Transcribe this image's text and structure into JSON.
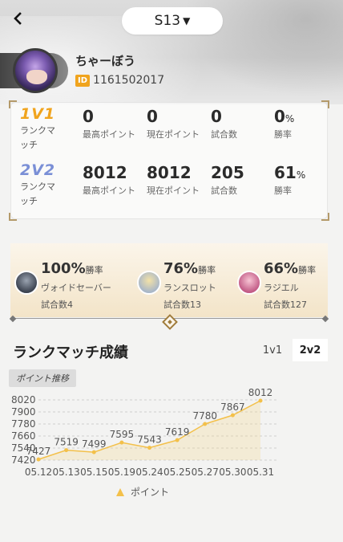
{
  "header": {
    "back_icon": "back-arrow-icon",
    "season": "S13",
    "season_arrow": "▼"
  },
  "profile": {
    "name": "ちゃーぼう",
    "id_badge": "ID",
    "id": "1161502017"
  },
  "modes": [
    {
      "badge": "1V1",
      "label": "ランクマッチ",
      "highest_points": "0",
      "highest_points_label": "最高ポイント",
      "current_points": "0",
      "current_points_label": "現在ポイント",
      "matches": "0",
      "matches_label": "試合数",
      "win_rate": "0",
      "win_rate_unit": "%",
      "win_rate_label": "勝率"
    },
    {
      "badge": "2V2",
      "label": "ランクマッチ",
      "highest_points": "8012",
      "highest_points_label": "最高ポイント",
      "current_points": "8012",
      "current_points_label": "現在ポイント",
      "matches": "205",
      "matches_label": "試合数",
      "win_rate": "61",
      "win_rate_unit": "%",
      "win_rate_label": "勝率"
    }
  ],
  "heroes": [
    {
      "rate": "100%",
      "rate_label": "勝率",
      "name": "ヴォイドセーバー",
      "matches": "試合数4"
    },
    {
      "rate": "76%",
      "rate_label": "勝率",
      "name": "ランスロット",
      "matches": "試合数13"
    },
    {
      "rate": "66%",
      "rate_label": "勝率",
      "name": "ラジエル",
      "matches": "試合数127"
    }
  ],
  "rank_section": {
    "title": "ランクマッチ成績",
    "tab_1v1": "1v1",
    "tab_2v2": "2v2",
    "selected_tab": "2v2",
    "chart_tag": "ポイント推移",
    "legend": "ポイント"
  },
  "colors": {
    "line": "#f3c04a",
    "gold_badge": "#f0a41e",
    "blue_badge": "#7a8fd6"
  },
  "chart_data": {
    "type": "line",
    "x": [
      "05.12",
      "05.13",
      "05.15",
      "05.19",
      "05.24",
      "05.25",
      "05.27",
      "05.30",
      "05.31"
    ],
    "series": [
      {
        "name": "ポイント",
        "values": [
          7427,
          7519,
          7499,
          7595,
          7543,
          7619,
          7780,
          7867,
          8012
        ]
      }
    ],
    "yticks": [
      8020,
      7900,
      7780,
      7660,
      7540,
      7420
    ],
    "ylim": [
      7420,
      8020
    ],
    "grid": true,
    "legend": "bottom-center"
  }
}
